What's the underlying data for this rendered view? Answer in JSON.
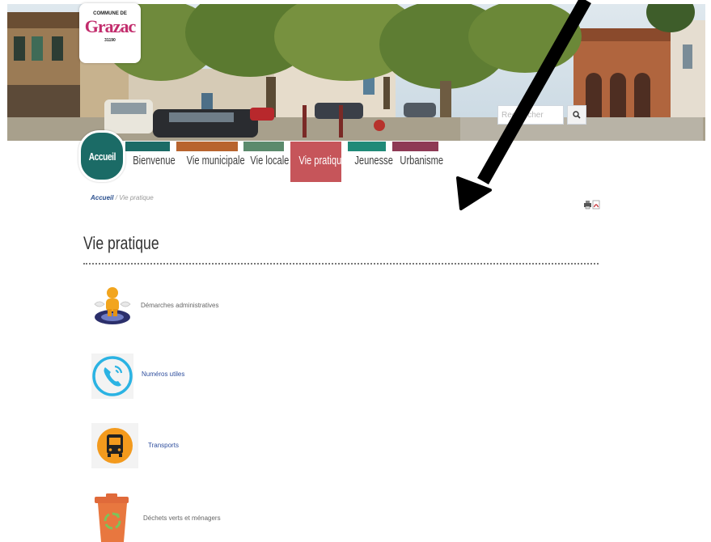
{
  "header": {
    "logo": {
      "top_text": "COMMUNE DE",
      "name": "Grazac",
      "postal_code": "31190"
    },
    "search": {
      "placeholder": "Rechercher",
      "button_icon": "search-icon"
    }
  },
  "nav": {
    "home_label": "Accueil",
    "items": [
      {
        "label": "Bienvenue",
        "color": "#1b6b66"
      },
      {
        "label": "Vie municipale",
        "color": "#b8642e"
      },
      {
        "label": "Vie locale",
        "color": "#5b8a6c"
      },
      {
        "label": "Vie pratique",
        "color": "#c6555a",
        "active": true
      },
      {
        "label": "Jeunesse",
        "color": "#208a78"
      },
      {
        "label": "Urbanisme",
        "color": "#8e3a55"
      }
    ]
  },
  "breadcrumb": {
    "home": "Accueil",
    "separator": "/",
    "current": "Vie pratique"
  },
  "tools": {
    "print_icon": "printer-icon",
    "pdf_icon": "pdf-icon"
  },
  "page": {
    "title": "Vie pratique",
    "entries": [
      {
        "label": "Démarches administratives",
        "icon": "administration-icon"
      },
      {
        "label": "Numéros utiles",
        "icon": "phone-icon"
      },
      {
        "label": "Transports",
        "icon": "bus-icon"
      },
      {
        "label": "Déchets verts et ménagers",
        "icon": "recycle-bin-icon"
      }
    ]
  },
  "annotation": {
    "arrow_icon": "arrow-icon",
    "color": "#000000"
  }
}
